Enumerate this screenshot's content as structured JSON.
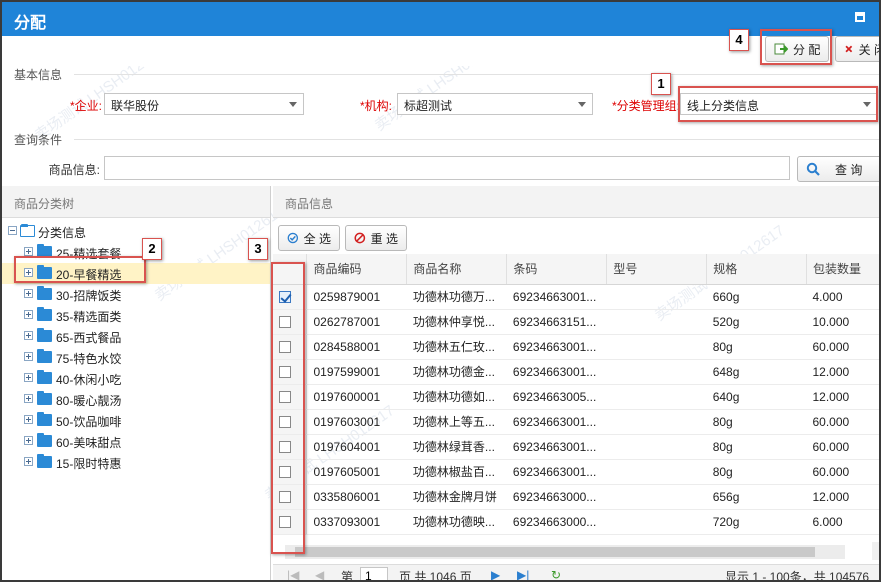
{
  "window": {
    "title": "分配"
  },
  "toolbar": {
    "assign_label": "分 配",
    "close_label": "关 闭"
  },
  "sections": {
    "basic": "基本信息",
    "query": "查询条件"
  },
  "form": {
    "enterprise": {
      "label": "企业:",
      "value": "联华股份"
    },
    "org": {
      "label": "机构:",
      "value": "标超测试"
    },
    "category": {
      "label": "分类管理组:",
      "value": "线上分类信息"
    },
    "product": {
      "label": "商品信息:",
      "value": ""
    },
    "query_label": "查 询"
  },
  "left_panel": {
    "title": "商品分类树",
    "root": "分类信息",
    "items": [
      {
        "label": "25-精选套餐"
      },
      {
        "label": "20-早餐精选"
      },
      {
        "label": "30-招牌饭类"
      },
      {
        "label": "35-精选面类"
      },
      {
        "label": "65-西式餐品"
      },
      {
        "label": "75-特色水饺"
      },
      {
        "label": "40-休闲小吃"
      },
      {
        "label": "80-暖心靓汤"
      },
      {
        "label": "50-饮品咖啡"
      },
      {
        "label": "60-美味甜点"
      },
      {
        "label": "15-限时特惠"
      }
    ]
  },
  "right_panel": {
    "title": "商品信息",
    "select_all": "全 选",
    "reselect": "重 选",
    "columns": [
      "商品编码",
      "商品名称",
      "条码",
      "型号",
      "规格",
      "包装数量"
    ],
    "rows": [
      {
        "code": "0259879001",
        "name": "功德林功德万...",
        "barcode": "69234663001...",
        "model": "",
        "spec": "660g",
        "qty": "4.000",
        "checked": true
      },
      {
        "code": "0262787001",
        "name": "功德林仲享悦...",
        "barcode": "69234663151...",
        "model": "",
        "spec": "520g",
        "qty": "10.000",
        "checked": false
      },
      {
        "code": "0284588001",
        "name": "功德林五仁玫...",
        "barcode": "69234663001...",
        "model": "",
        "spec": "80g",
        "qty": "60.000",
        "checked": false
      },
      {
        "code": "0197599001",
        "name": "功德林功德金...",
        "barcode": "69234663001...",
        "model": "",
        "spec": "648g",
        "qty": "12.000",
        "checked": false
      },
      {
        "code": "0197600001",
        "name": "功德林功德如...",
        "barcode": "69234663005...",
        "model": "",
        "spec": "640g",
        "qty": "12.000",
        "checked": false
      },
      {
        "code": "0197603001",
        "name": "功德林上等五...",
        "barcode": "69234663001...",
        "model": "",
        "spec": "80g",
        "qty": "60.000",
        "checked": false
      },
      {
        "code": "0197604001",
        "name": "功德林绿茸香...",
        "barcode": "69234663001...",
        "model": "",
        "spec": "80g",
        "qty": "60.000",
        "checked": false
      },
      {
        "code": "0197605001",
        "name": "功德林椒盐百...",
        "barcode": "69234663001...",
        "model": "",
        "spec": "80g",
        "qty": "60.000",
        "checked": false
      },
      {
        "code": "0335806001",
        "name": "功德林金牌月饼",
        "barcode": "69234663000...",
        "model": "",
        "spec": "656g",
        "qty": "12.000",
        "checked": false
      },
      {
        "code": "0337093001",
        "name": "功德林功德映...",
        "barcode": "69234663000...",
        "model": "",
        "spec": "720g",
        "qty": "6.000",
        "checked": false
      }
    ]
  },
  "pager": {
    "page_prefix": "第",
    "page_value": "1",
    "page_suffix": "页 共 1046 页",
    "summary": "显示 1 - 100条，共 104576"
  },
  "annotations": [
    "1",
    "2",
    "3",
    "4"
  ],
  "colors": {
    "titlebar": "#1f84d8",
    "annotation": "#d9534f",
    "selected_row": "#fff3c6"
  }
}
